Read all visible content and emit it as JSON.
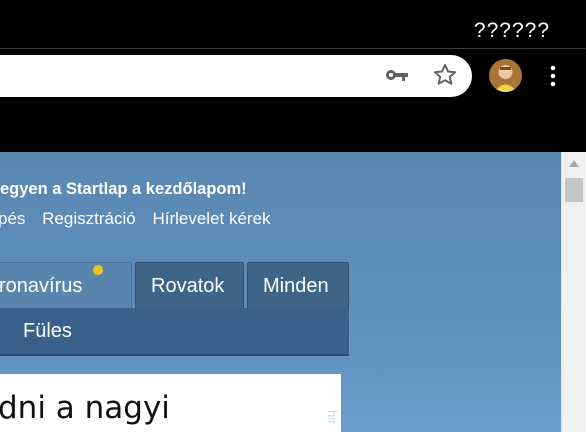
{
  "window": {
    "title": "??????"
  },
  "toolbar": {
    "key_icon": "key-icon",
    "star_icon": "star-icon",
    "menu_icon": "kebab-menu-icon"
  },
  "page": {
    "welcome": "egyen a Startlap a kezdőlapom!",
    "links": [
      "pés",
      "Regisztráció",
      "Hírlevelet kérek"
    ],
    "tabs": [
      "ronavírus",
      "Rovatok",
      "Minden"
    ],
    "subnav": "Füles",
    "article_headline": "dni a nagyi",
    "side_label": "hir"
  },
  "colors": {
    "page_bg": "#5d8cb8",
    "tab_bg": "#3e6488",
    "active_tab_bg": "#5a86ae",
    "notification_dot": "#f0c419"
  }
}
